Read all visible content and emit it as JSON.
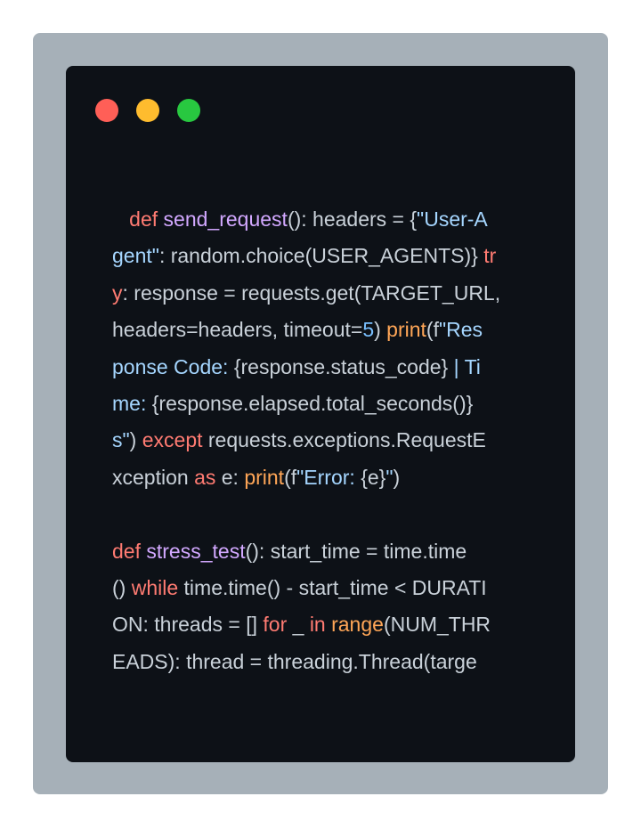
{
  "window": {
    "controls": [
      {
        "name": "close",
        "color": "#ff5f57"
      },
      {
        "name": "minimize",
        "color": "#febc2e"
      },
      {
        "name": "maximize",
        "color": "#28c840"
      }
    ]
  },
  "code": {
    "lines": [
      [
        [
          "tx",
          "   "
        ],
        [
          "kw",
          "def"
        ],
        [
          "tx",
          " "
        ],
        [
          "fn",
          "send_request"
        ],
        [
          "tx",
          "(): headers = {"
        ],
        [
          "str",
          "\"User-A"
        ]
      ],
      [
        [
          "str",
          "gent\""
        ],
        [
          "tx",
          ": random.choice(USER_AGENTS)} "
        ],
        [
          "kw",
          "tr"
        ]
      ],
      [
        [
          "kw",
          "y"
        ],
        [
          "tx",
          ": response = requests.get(TARGET_URL,"
        ]
      ],
      [
        [
          "tx",
          "headers=headers, timeout="
        ],
        [
          "num",
          "5"
        ],
        [
          "tx",
          ") "
        ],
        [
          "bi",
          "print"
        ],
        [
          "tx",
          "(f"
        ],
        [
          "str",
          "\"Res"
        ]
      ],
      [
        [
          "str",
          "ponse Code: "
        ],
        [
          "tx",
          "{response.status_code}"
        ],
        [
          "str",
          " | Ti"
        ]
      ],
      [
        [
          "str",
          "me: "
        ],
        [
          "tx",
          "{response.elapsed.total_seconds()}"
        ]
      ],
      [
        [
          "str",
          "s\""
        ],
        [
          "tx",
          ") "
        ],
        [
          "kw",
          "except"
        ],
        [
          "tx",
          " requests.exceptions.RequestE"
        ]
      ],
      [
        [
          "tx",
          "xception "
        ],
        [
          "kw",
          "as"
        ],
        [
          "tx",
          " e: "
        ],
        [
          "bi",
          "print"
        ],
        [
          "tx",
          "(f"
        ],
        [
          "str",
          "\"Error: "
        ],
        [
          "tx",
          "{e}"
        ],
        [
          "str",
          "\""
        ],
        [
          "tx",
          ")"
        ]
      ],
      [],
      [
        [
          "kw",
          "def"
        ],
        [
          "tx",
          " "
        ],
        [
          "fn",
          "stress_test"
        ],
        [
          "tx",
          "(): start_time = time.time"
        ]
      ],
      [
        [
          "tx",
          "() "
        ],
        [
          "kw",
          "while"
        ],
        [
          "tx",
          " time.time() - start_time < DURATI"
        ]
      ],
      [
        [
          "tx",
          "ON: threads = [] "
        ],
        [
          "kw",
          "for"
        ],
        [
          "tx",
          " _ "
        ],
        [
          "kw",
          "in"
        ],
        [
          "tx",
          " "
        ],
        [
          "bi",
          "range"
        ],
        [
          "tx",
          "(NUM_THR"
        ]
      ],
      [
        [
          "tx",
          "EADS): thread = threading.Thread(targe"
        ]
      ]
    ]
  }
}
